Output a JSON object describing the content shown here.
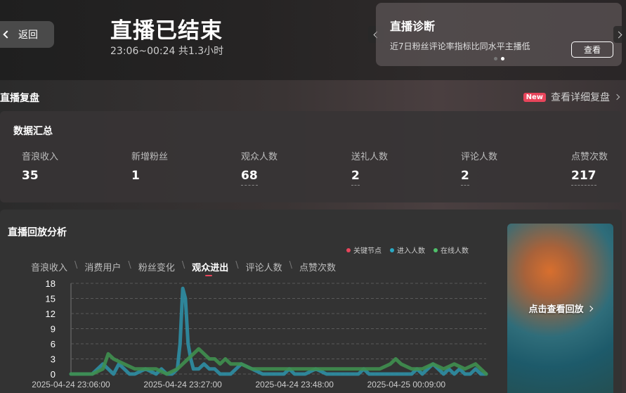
{
  "header": {
    "back_label": "返回",
    "title": "直播已结束",
    "subtitle": "23:06~00:24 共1.3小时"
  },
  "diagnosis": {
    "title": "直播诊断",
    "desc": "近7日粉丝评论率指标比同水平主播低",
    "button": "查看"
  },
  "review": {
    "title": "直播复盘",
    "badge": "New",
    "detail_link": "查看详细复盘"
  },
  "summary": {
    "title": "数据汇总",
    "metrics": [
      {
        "label": "音浪收入",
        "value": "35"
      },
      {
        "label": "新增粉丝",
        "value": "1"
      },
      {
        "label": "观众人数",
        "value": "68"
      },
      {
        "label": "送礼人数",
        "value": "2"
      },
      {
        "label": "评论人数",
        "value": "2"
      },
      {
        "label": "点赞次数",
        "value": "217"
      }
    ]
  },
  "replay": {
    "title": "直播回放分析",
    "tabs": [
      "音浪收入",
      "消费用户",
      "粉丝变化",
      "观众进出",
      "评论人数",
      "点赞次数"
    ],
    "active_tab": 3,
    "legend": [
      {
        "label": "关键节点",
        "color": "#e8455b"
      },
      {
        "label": "进入人数",
        "color": "#29a9c4"
      },
      {
        "label": "在线人数",
        "color": "#4fc06a"
      }
    ],
    "video_label": "点击查看回放"
  },
  "chart_data": {
    "type": "line",
    "ylim": [
      0,
      18
    ],
    "y_ticks": [
      "18",
      "15",
      "12",
      "9",
      "6",
      "3",
      "0"
    ],
    "x_tick_labels": [
      "2025-04-24 23:06:00",
      "2025-04-24 23:27:00",
      "2025-04-24 23:48:00",
      "2025-04-25 00:09:00"
    ],
    "x_range_minutes": [
      0,
      78
    ],
    "grid": true,
    "series": [
      {
        "name": "进入人数",
        "color": "#2e8ea4",
        "x": [
          0,
          4,
          6,
          7,
          8,
          9,
          10,
          11,
          12,
          14,
          16,
          17,
          18,
          19,
          20,
          20.5,
          21,
          21.5,
          22,
          22.5,
          23,
          24,
          25,
          26,
          27,
          28,
          30,
          31,
          32,
          34,
          36,
          38,
          40,
          41,
          42,
          44,
          46,
          48,
          50,
          52,
          54,
          55,
          56,
          58,
          60,
          62,
          64,
          65,
          66,
          67,
          68,
          69,
          70,
          71,
          72,
          73,
          74,
          75,
          76,
          77,
          78
        ],
        "y": [
          0,
          0,
          2,
          1,
          0,
          2,
          1,
          0,
          0,
          1,
          0,
          1,
          0,
          0,
          1,
          6,
          17,
          15,
          6,
          3,
          1,
          1,
          2,
          1,
          1,
          0,
          0,
          1,
          2,
          1,
          0,
          0,
          0,
          1,
          0,
          0,
          1,
          0,
          0,
          0,
          0,
          1,
          0,
          0,
          0,
          0,
          0,
          1,
          0,
          1,
          2,
          1,
          0,
          1,
          0,
          1,
          0,
          0,
          1,
          0,
          0
        ]
      },
      {
        "name": "在线人数",
        "color": "#3f8f4f",
        "x": [
          0,
          4,
          6,
          7,
          8,
          10,
          12,
          14,
          16,
          18,
          20,
          21,
          22,
          23,
          24,
          25,
          26,
          27,
          28,
          29,
          30,
          31,
          32,
          34,
          36,
          38,
          40,
          42,
          44,
          46,
          48,
          50,
          52,
          54,
          56,
          58,
          60,
          61,
          62,
          64,
          66,
          68,
          70,
          72,
          74,
          76,
          78
        ],
        "y": [
          0,
          0,
          1,
          4,
          3,
          2,
          1,
          1,
          1,
          0,
          1,
          2,
          3,
          4,
          5,
          4,
          3,
          3,
          2,
          3,
          2,
          2,
          2,
          1,
          1,
          1,
          1,
          1,
          1,
          1,
          1,
          1,
          1,
          1,
          1,
          1,
          2,
          3,
          2,
          1,
          1,
          2,
          1,
          2,
          1,
          2,
          0
        ]
      }
    ]
  }
}
